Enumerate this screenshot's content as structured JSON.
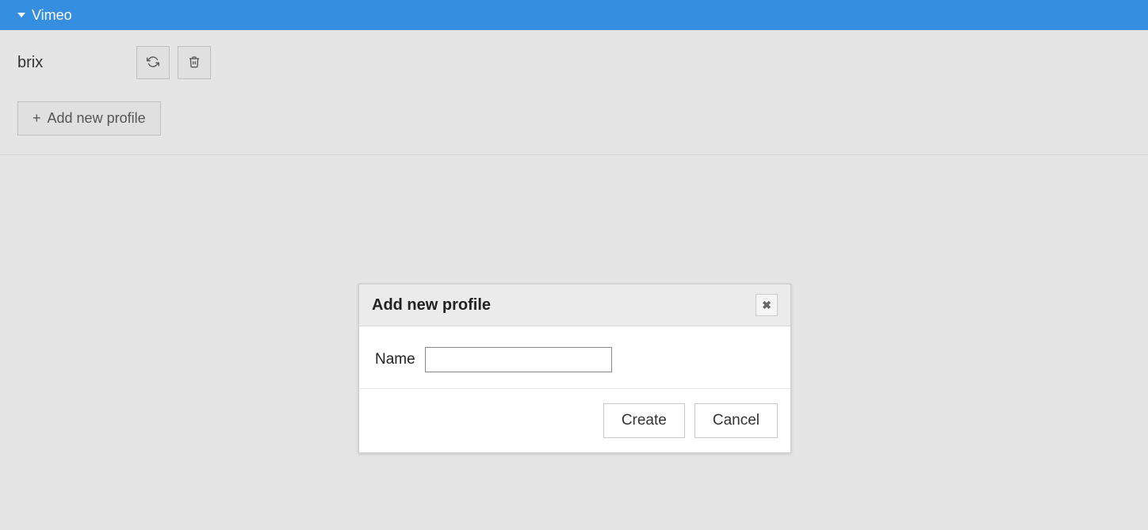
{
  "header": {
    "title": "Vimeo"
  },
  "profile": {
    "name": "brix"
  },
  "buttons": {
    "add_profile_label": "Add new profile"
  },
  "dialog": {
    "title": "Add new profile",
    "name_label": "Name",
    "name_value": "",
    "create_label": "Create",
    "cancel_label": "Cancel"
  }
}
